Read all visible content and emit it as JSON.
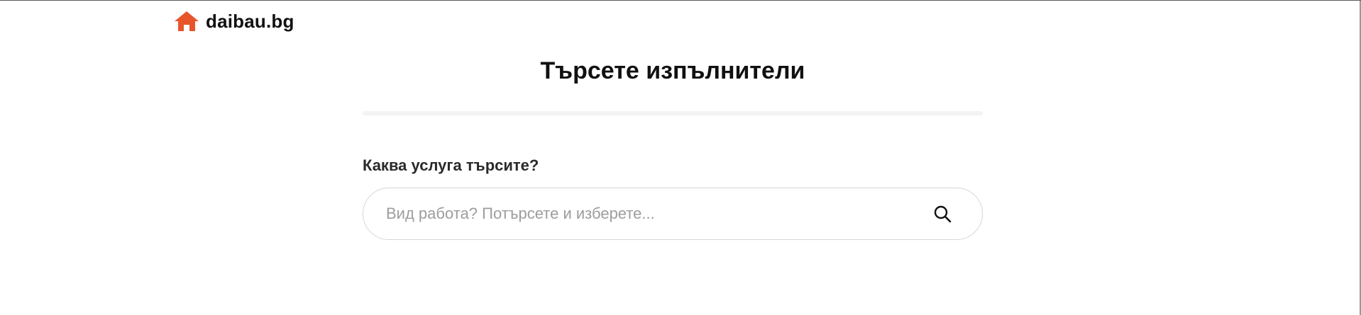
{
  "brand": {
    "name": "daibau.bg",
    "accent_color": "#e8552a"
  },
  "main": {
    "title": "Търсете изпълнители"
  },
  "search": {
    "label": "Каква услуга търсите?",
    "placeholder": "Вид работа? Потърсете и изберете...",
    "value": "",
    "icon": "search-icon"
  }
}
